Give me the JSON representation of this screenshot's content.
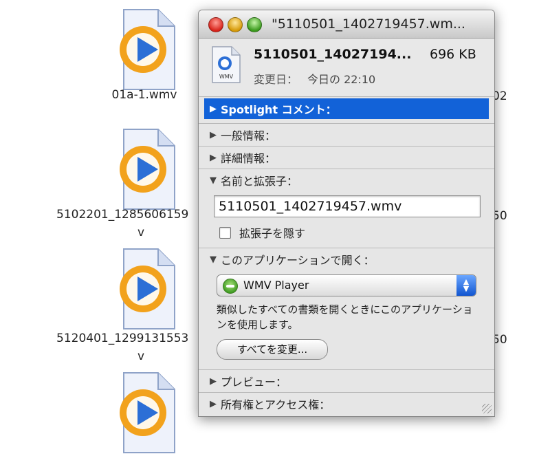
{
  "desktop": {
    "files": [
      {
        "name": "01a-1.wmv",
        "name_line2": ""
      },
      {
        "name": "5102201_1285606159",
        "name_line2": "v"
      },
      {
        "name": "5120401_1299131553",
        "name_line2": "v"
      },
      {
        "name": "",
        "name_line2": ""
      }
    ],
    "right_partial_labels": [
      "02",
      "50",
      "50"
    ]
  },
  "window": {
    "title": "\"5110501_1402719457.wm...",
    "header": {
      "name": "5110501_14027194...",
      "size": "696 KB",
      "modified_label": "変更日：",
      "modified_value": "今日の 22:10",
      "icon_badge": "WMV",
      "icon": "wmv-document-icon"
    },
    "sections": {
      "spotlight": "Spotlight コメント：",
      "general": "一般情報：",
      "more_info": "詳細情報：",
      "name_ext": "名前と拡張子：",
      "open_with": "このアプリケーションで開く：",
      "preview": "プレビュー：",
      "ownership": "所有権とアクセス権："
    },
    "name_field_value": "5110501_1402719457.wmv",
    "hide_extension_label": "拡張子を隠す",
    "hide_extension_checked": false,
    "app_popup_selected": "WMV Player",
    "open_with_desc": "類似したすべての書類を開くときにこのアプリケーションを使用します。",
    "change_all_label": "すべてを変更..."
  },
  "colors": {
    "selection": "#1262d8",
    "icon_orange": "#f2a21c",
    "icon_blue": "#2c6fd6"
  }
}
